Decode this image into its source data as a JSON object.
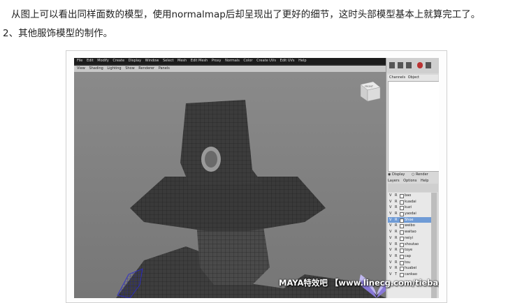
{
  "article": {
    "para1": "从图上可以看出同样面数的模型，使用normalmap后却呈现出了更好的细节，这时头部模型基本上就算完工了。",
    "para2": "2、其他服饰模型的制作。"
  },
  "maya": {
    "menu": [
      "File",
      "Edit",
      "Modify",
      "Create",
      "Display",
      "Window",
      "Select",
      "Mesh",
      "Edit Mesh",
      "Proxy",
      "Normals",
      "Color",
      "Create UVs",
      "Edit UVs",
      "Help"
    ],
    "panel_menu": [
      "View",
      "Shading",
      "Lighting",
      "Show",
      "Renderer",
      "Panels"
    ],
    "viewcube_label": "FRONT",
    "channel_tabs": [
      "Channels",
      "Object"
    ],
    "layer_mode": {
      "display": "Display",
      "render": "Render"
    },
    "layer_menu": [
      "Layers",
      "Options",
      "Help"
    ],
    "layers": [
      {
        "v": "V",
        "r": "R",
        "name": "bao"
      },
      {
        "v": "V",
        "r": "R",
        "name": "kuadai"
      },
      {
        "v": "V",
        "r": "R",
        "name": "kuzi"
      },
      {
        "v": "V",
        "r": "R",
        "name": "yaodai"
      },
      {
        "v": "V",
        "r": "R",
        "name": "Shoe",
        "selected": true
      },
      {
        "v": "V",
        "r": "R",
        "name": "weibo"
      },
      {
        "v": "V",
        "r": "R",
        "name": "waitao"
      },
      {
        "v": "V",
        "r": "R",
        "name": "neiyi"
      },
      {
        "v": "V",
        "r": "R",
        "name": "shoutao"
      },
      {
        "v": "V",
        "r": "R",
        "name": "toye"
      },
      {
        "v": "V",
        "r": "R",
        "name": "cap"
      },
      {
        "v": "V",
        "r": "R",
        "name": "tou"
      },
      {
        "v": "V",
        "r": "R",
        "name": "huabei"
      },
      {
        "v": "V",
        "r": "T",
        "name": "cankao"
      }
    ]
  },
  "watermark": "MAYA特效吧 【www.linecg.com/tieba/1745】",
  "colors": {
    "viewport": "#808080",
    "selection": "#6f9bd6",
    "mesh": "#3a3a3a",
    "wire": "#1a1a1a"
  }
}
